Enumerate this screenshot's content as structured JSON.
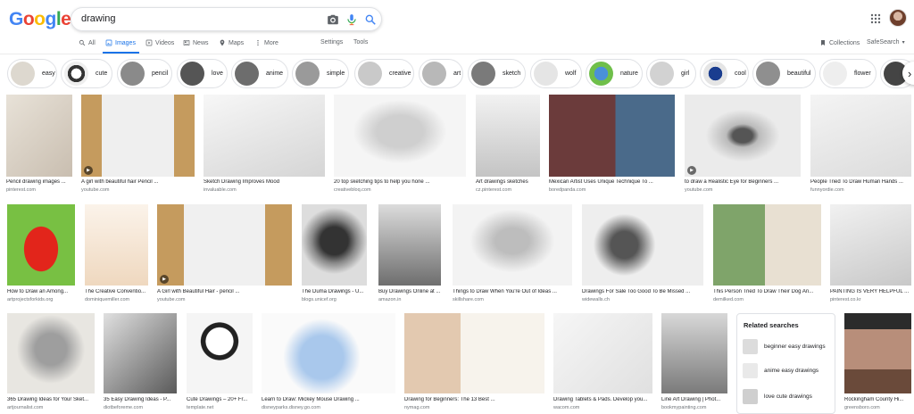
{
  "logo": {
    "letters": [
      "G",
      "o",
      "o",
      "g",
      "l",
      "e"
    ],
    "colors": [
      "#4285f4",
      "#ea4335",
      "#fbbc05",
      "#4285f4",
      "#34a853",
      "#ea4335"
    ]
  },
  "search": {
    "query": "drawing"
  },
  "tabs": [
    {
      "label": "All",
      "icon": "search-icon"
    },
    {
      "label": "Images",
      "icon": "image-icon",
      "active": true
    },
    {
      "label": "Videos",
      "icon": "video-icon"
    },
    {
      "label": "News",
      "icon": "news-icon"
    },
    {
      "label": "Maps",
      "icon": "map-pin-icon"
    },
    {
      "label": "More",
      "icon": "more-vert-icon"
    }
  ],
  "tools": {
    "settings": "Settings",
    "tools": "Tools",
    "collections": "Collections",
    "safesearch": "SafeSearch"
  },
  "chips": [
    "easy",
    "cute",
    "pencil",
    "love",
    "anime",
    "simple",
    "creative",
    "art",
    "sketch",
    "wolf",
    "nature",
    "girl",
    "cool",
    "beautiful",
    "flower"
  ],
  "results": [
    {
      "title": "Pencil drawing images ...",
      "source": "pinterest.com"
    },
    {
      "title": "A girl with beautiful hair Pencil ...",
      "source": "youtube.com"
    },
    {
      "title": "Sketch Drawing Improves Mood",
      "source": "invaluable.com"
    },
    {
      "title": "20 top sketching tips to help you hone ...",
      "source": "creativebloq.com"
    },
    {
      "title": "Art drawings sketches",
      "source": "cz.pinterest.com"
    },
    {
      "title": "Mexican Artist Uses Unique Technique To ...",
      "source": "boredpanda.com"
    },
    {
      "title": "to draw a Realistic Eye for Beginners ...",
      "source": "youtube.com"
    },
    {
      "title": "People Tried To Draw Human Hands ...",
      "source": "funnyordie.com"
    },
    {
      "title": "How to Draw an Among...",
      "source": "artprojectsforkids.org"
    },
    {
      "title": "The Creative Conventio...",
      "source": "dominiquemiller.com"
    },
    {
      "title": "A Girl with Beautiful Hair - pencil ...",
      "source": "youtube.com"
    },
    {
      "title": "The Duma Drawings - U...",
      "source": "blogs.unicef.org"
    },
    {
      "title": "Buy Drawings Online at ...",
      "source": "amazon.in"
    },
    {
      "title": "Things to Draw When You're Out of Ideas ...",
      "source": "skillshare.com"
    },
    {
      "title": "Drawings For Sale Too Good To Be Missed ...",
      "source": "widewalls.ch"
    },
    {
      "title": "This Person Tried To Draw Their Dog An...",
      "source": "demilked.com"
    },
    {
      "title": "PAINTING IS VERY HELPFUL ...",
      "source": "pinterest.co.kr"
    },
    {
      "title": "365 Drawing Ideas for Your Sket...",
      "source": "artjournalist.com"
    },
    {
      "title": "35 Easy Drawing Ideas - P...",
      "source": "diotbeforeme.com"
    },
    {
      "title": "Cute Drawings – 20+ Fr...",
      "source": "template.net"
    },
    {
      "title": "Learn to Draw: Mickey Mouse Drawing ...",
      "source": "disneyparks.disney.go.com"
    },
    {
      "title": "Drawing for Beginners: The 13 Best ...",
      "source": "nymag.com"
    },
    {
      "title": "Drawing Tablets & Pads. Develop you...",
      "source": "wacom.com"
    },
    {
      "title": "Line Art Drawing | Phot...",
      "source": "bookmypainting.com"
    },
    {
      "title": "Rockingham County Hi...",
      "source": "greensboro.com"
    }
  ],
  "related": {
    "title": "Related searches",
    "items": [
      "beginner easy drawings",
      "anime easy drawings",
      "love cute drawings"
    ]
  }
}
